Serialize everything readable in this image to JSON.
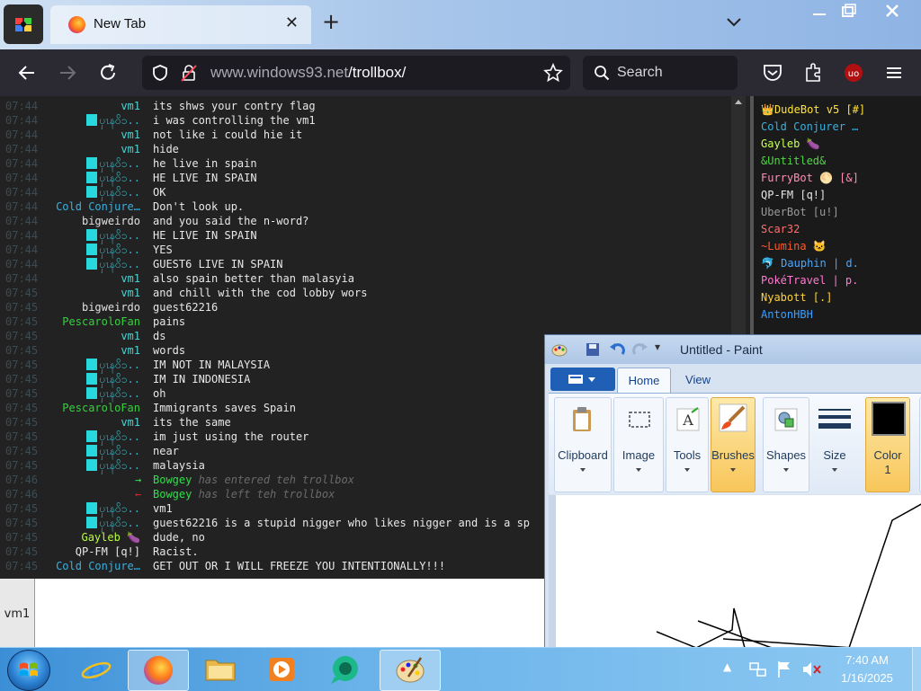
{
  "browser": {
    "tab_title": "New Tab",
    "url_host": "www.windows93.net",
    "url_path": "/trollbox/",
    "search_placeholder": "Search"
  },
  "chat": {
    "messages": [
      {
        "time": "07:44",
        "nick": "vm1",
        "nick_style": "vm1",
        "text": "its shws your contry flag"
      },
      {
        "time": "07:44",
        "nick": "ၦၤန၀ိၥ..",
        "nick_style": "myan",
        "text": "i was controlling the vm1"
      },
      {
        "time": "07:44",
        "nick": "vm1",
        "nick_style": "vm1",
        "text": "not like i could hie it"
      },
      {
        "time": "07:44",
        "nick": "vm1",
        "nick_style": "vm1",
        "text": "hide"
      },
      {
        "time": "07:44",
        "nick": "ၦၤန၀ိၥ..",
        "nick_style": "myan",
        "text": "he live in spain"
      },
      {
        "time": "07:44",
        "nick": "ၦၤန၀ိၥ..",
        "nick_style": "myan",
        "text": "HE LIVE IN SPAIN"
      },
      {
        "time": "07:44",
        "nick": "ၦၤန၀ိၥ..",
        "nick_style": "myan",
        "text": "OK"
      },
      {
        "time": "07:44",
        "nick": "Cold Conjure…",
        "nick_style": "cold",
        "text": "Don't look up."
      },
      {
        "time": "07:44",
        "nick": "bigweirdo",
        "nick_style": "big",
        "text": "and you said the n-word?"
      },
      {
        "time": "07:44",
        "nick": "ၦၤန၀ိၥ..",
        "nick_style": "myan",
        "text": "HE LIVE IN SPAIN"
      },
      {
        "time": "07:44",
        "nick": "ၦၤန၀ိၥ..",
        "nick_style": "myan",
        "text": "YES"
      },
      {
        "time": "07:44",
        "nick": "ၦၤန၀ိၥ..",
        "nick_style": "myan",
        "text": "GUEST6 LIVE IN SPAIN"
      },
      {
        "time": "07:44",
        "nick": "vm1",
        "nick_style": "vm1",
        "text": "also spain better than malasyia"
      },
      {
        "time": "07:45",
        "nick": "vm1",
        "nick_style": "vm1",
        "text": "and chill with the cod lobby wors"
      },
      {
        "time": "07:45",
        "nick": "bigweirdo",
        "nick_style": "big",
        "text": "guest62216"
      },
      {
        "time": "07:45",
        "nick": "PescaroloFan",
        "nick_style": "pes",
        "text": "pains"
      },
      {
        "time": "07:45",
        "nick": "vm1",
        "nick_style": "vm1",
        "text": "ds"
      },
      {
        "time": "07:45",
        "nick": "vm1",
        "nick_style": "vm1",
        "text": "words"
      },
      {
        "time": "07:45",
        "nick": "ၦၤန၀ိၥ..",
        "nick_style": "myan",
        "text": "IM NOT IN MALAYSIA"
      },
      {
        "time": "07:45",
        "nick": "ၦၤန၀ိၥ..",
        "nick_style": "myan",
        "text": "IM IN INDONESIA"
      },
      {
        "time": "07:45",
        "nick": "ၦၤန၀ိၥ..",
        "nick_style": "myan",
        "text": "oh"
      },
      {
        "time": "07:45",
        "nick": "PescaroloFan",
        "nick_style": "pes",
        "text": "Immigrants saves Spain"
      },
      {
        "time": "07:45",
        "nick": "vm1",
        "nick_style": "vm1",
        "text": "its the same"
      },
      {
        "time": "07:45",
        "nick": "ၦၤန၀ိၥ..",
        "nick_style": "myan",
        "text": "im just using the router"
      },
      {
        "time": "07:45",
        "nick": "ၦၤန၀ိၥ..",
        "nick_style": "myan",
        "text": "near"
      },
      {
        "time": "07:45",
        "nick": "ၦၤန၀ိၥ..",
        "nick_style": "myan",
        "text": "malaysia"
      },
      {
        "time": "07:46",
        "system": true,
        "arrow": "→",
        "arrow_color": "#2fe04a",
        "who": "Bowgey",
        "text": " has entered teh trollbox"
      },
      {
        "time": "07:46",
        "system": true,
        "arrow": "←",
        "arrow_color": "#e02020",
        "who": "Bowgey",
        "text": " has left teh trollbox"
      },
      {
        "time": "07:45",
        "nick": "ၦၤန၀ိၥ..",
        "nick_style": "myan",
        "text": "vm1"
      },
      {
        "time": "07:45",
        "nick": "ၦၤန၀ိၥ..",
        "nick_style": "myan",
        "text": "guest62216 is a stupid nigger who likes nigger and is a sp"
      },
      {
        "time": "07:45",
        "nick": "Gayleb 🍆",
        "nick_style": "gay",
        "text": "dude, no"
      },
      {
        "time": "07:45",
        "nick": "QP-FM [q!]",
        "nick_style": "qp",
        "text": "Racist."
      },
      {
        "time": "07:45",
        "nick": "Cold Conjure…",
        "nick_style": "cold",
        "text": "GET OUT OR I WILL FREEZE YOU INTENTIONALLY!!!"
      }
    ],
    "input_nick": "vm1"
  },
  "userlist": [
    {
      "name": "👑DudeBot v5 [#]",
      "color": "#ffe23a"
    },
    {
      "name": "Cold Conjurer …",
      "color": "#3ab0e0"
    },
    {
      "name": "Gayleb 🍆",
      "color": "#c8ff58"
    },
    {
      "name": "&Untitled&",
      "color": "#55d44a"
    },
    {
      "name": "FurryBot 🌕 [&]",
      "color": "#ff8fb8"
    },
    {
      "name": "QP-FM [q!]",
      "color": "#e6e6e6"
    },
    {
      "name": "UberBot [u!]",
      "color": "#9a9a9a"
    },
    {
      "name": "Scar32",
      "color": "#ff6e6e"
    },
    {
      "name": "~Lumina 🐱",
      "color": "#ff5a2a"
    },
    {
      "name": "🐬 Dauphin | d.",
      "color": "#4aa8ff"
    },
    {
      "name": "PokéTravel | p.",
      "color": "#ff7ad0"
    },
    {
      "name": "Nyabott [.]",
      "color": "#ffd23a"
    },
    {
      "name": "AntonHBH",
      "color": "#3aa0ff"
    }
  ],
  "paint": {
    "title": "Untitled - Paint",
    "tabs": [
      "Home",
      "View"
    ],
    "groups": [
      {
        "label": "Clipboard",
        "sub": ""
      },
      {
        "label": "Image",
        "sub": ""
      },
      {
        "label": "Tools",
        "sub": ""
      },
      {
        "label": "Brushes",
        "sub": ""
      },
      {
        "label": "Shapes",
        "sub": ""
      },
      {
        "label": "Size",
        "sub": ""
      },
      {
        "label": "Color",
        "sub": "1"
      },
      {
        "label": "C",
        "sub": ""
      }
    ]
  },
  "taskbar": {
    "time": "7:40 AM",
    "date": "1/16/2025"
  },
  "colors": {
    "browser_toolbar": "#2b2a33",
    "chat_bg": "#222222",
    "taskbar": "#3c8fd6"
  }
}
